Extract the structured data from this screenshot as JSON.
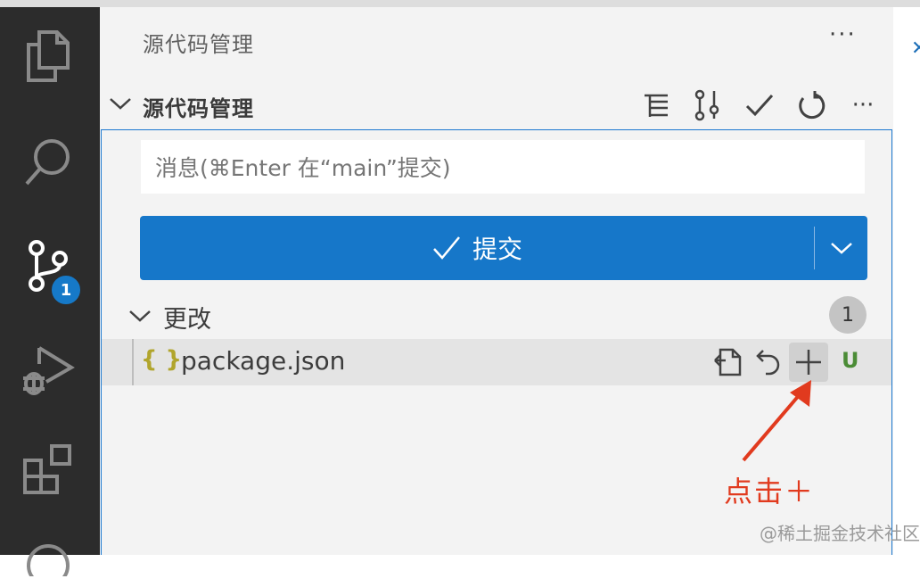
{
  "activity_bar": {
    "icons": [
      "explorer-icon",
      "search-icon",
      "source-control-icon",
      "run-debug-icon",
      "extensions-icon",
      "account-icon"
    ],
    "badge": "1"
  },
  "view": {
    "title": "源代码管理",
    "more": "···"
  },
  "section": {
    "title": "源代码管理",
    "toolbar": [
      "view-as-tree-icon",
      "branch-icon",
      "check-icon",
      "refresh-icon",
      "more-icon"
    ],
    "more": "···"
  },
  "commit": {
    "placeholder": "消息(⌘Enter 在“main”提交)",
    "button_label": "提交",
    "button_check": "✓"
  },
  "changes": {
    "title": "更改",
    "count": "1",
    "files": [
      {
        "icon": "{ }",
        "name": "package.json",
        "status": "U"
      }
    ]
  },
  "annotation": {
    "text": "点击＋"
  },
  "watermark": "@稀土掘金技术社区",
  "colors": {
    "accent": "#1677c9",
    "activity_bg": "#2c2c2c",
    "sidebar_bg": "#f3f3f3",
    "annotation": "#e13a1e",
    "untracked": "#4b8c36"
  }
}
